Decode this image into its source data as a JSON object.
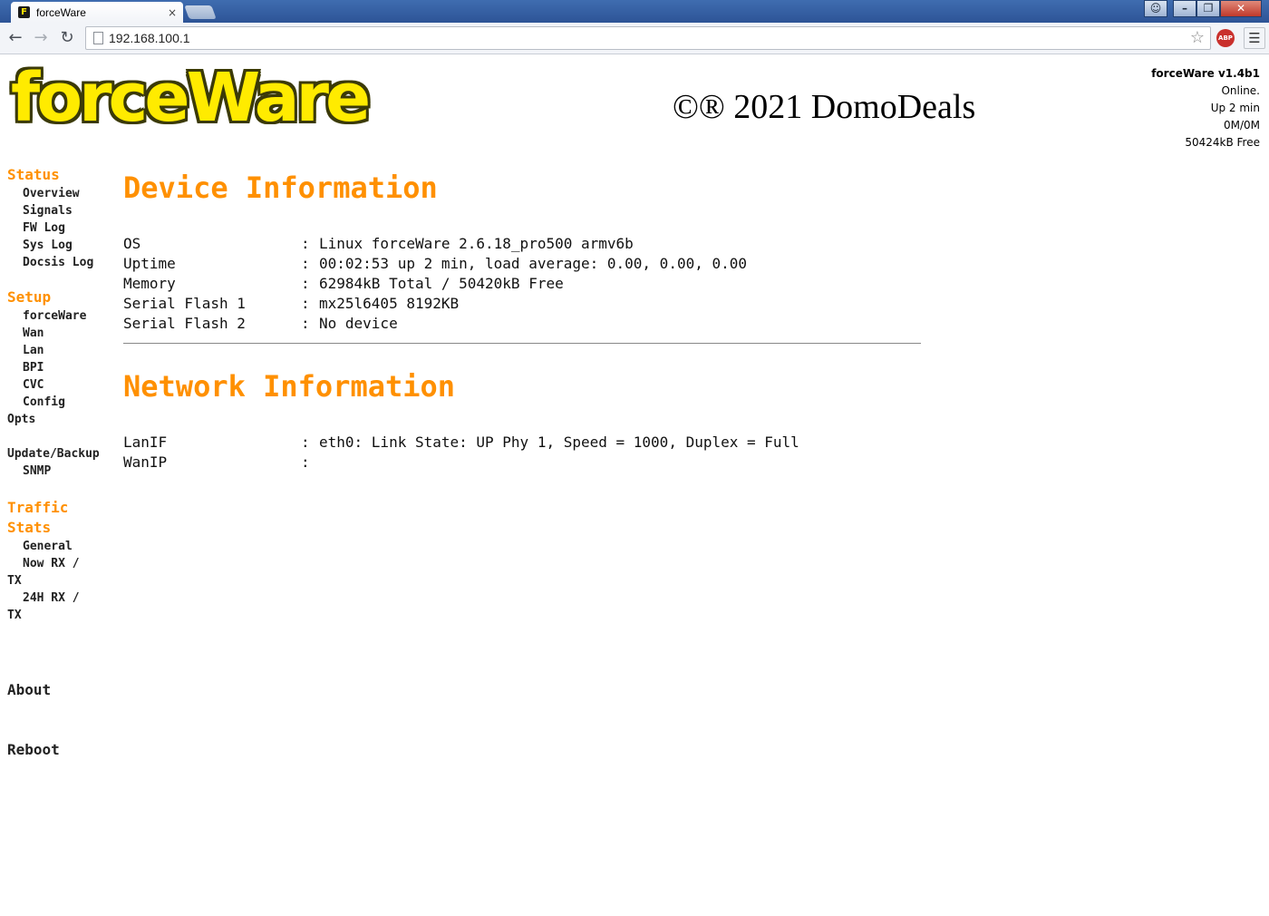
{
  "browser": {
    "tab_title": "forceWare",
    "tab_favicon": "F",
    "tab_close": "×",
    "address": "192.168.100.1",
    "icons": {
      "back": "back-arrow-icon",
      "forward": "forward-arrow-icon",
      "reload": "reload-icon",
      "star": "star-icon",
      "adblock": "adblock-icon",
      "menu": "hamburger-menu-icon"
    },
    "abp_label": "ABP",
    "window_buttons": {
      "profile": "☺",
      "minimize": "–",
      "maximize": "❐",
      "close": "✕"
    }
  },
  "header": {
    "logo": "forceWare",
    "copyright": "©® 2021 DomoDeals",
    "status": {
      "version": "forceWare v1.4b1",
      "state": "Online.",
      "uptime": "Up 2 min",
      "traffic": "0M/0M",
      "free": "50424kB Free"
    }
  },
  "sidebar": {
    "status": {
      "label": "Status",
      "items": [
        "Overview",
        "Signals",
        "FW Log",
        "Sys Log",
        "Docsis Log"
      ]
    },
    "setup": {
      "label": "Setup",
      "items": [
        "forceWare",
        "Wan",
        "Lan",
        "BPI",
        "CVC",
        "Config"
      ],
      "opts": "Opts",
      "update_backup": "Update/Backup",
      "snmp": "SNMP"
    },
    "traffic": {
      "label_1": "Traffic",
      "label_2": "Stats",
      "general": "General",
      "now_1": "Now RX /",
      "now_2": "TX",
      "day_1": "24H RX /",
      "day_2": "TX"
    },
    "about": "About",
    "reboot": "Reboot"
  },
  "device_info": {
    "title": "Device Information",
    "rows": [
      {
        "key": "OS",
        "value": "Linux forceWare 2.6.18_pro500 armv6b"
      },
      {
        "key": "Uptime",
        "value": "00:02:53 up 2 min, load average: 0.00, 0.00, 0.00"
      },
      {
        "key": "Memory",
        "value": "62984kB Total / 50420kB Free"
      },
      {
        "key": "Serial Flash 1",
        "value": "mx25l6405 8192KB"
      },
      {
        "key": "Serial Flash 2",
        "value": "No device"
      }
    ]
  },
  "network_info": {
    "title": "Network Information",
    "rows": [
      {
        "key": "LanIF",
        "value": "eth0: Link State: UP Phy 1, Speed = 1000, Duplex = Full"
      },
      {
        "key": "WanIP",
        "value": ""
      }
    ]
  },
  "separator": ":",
  "colors": {
    "accent": "#ff9000",
    "logo_fill": "#ffeb00",
    "logo_outline": "#3b3a08"
  }
}
